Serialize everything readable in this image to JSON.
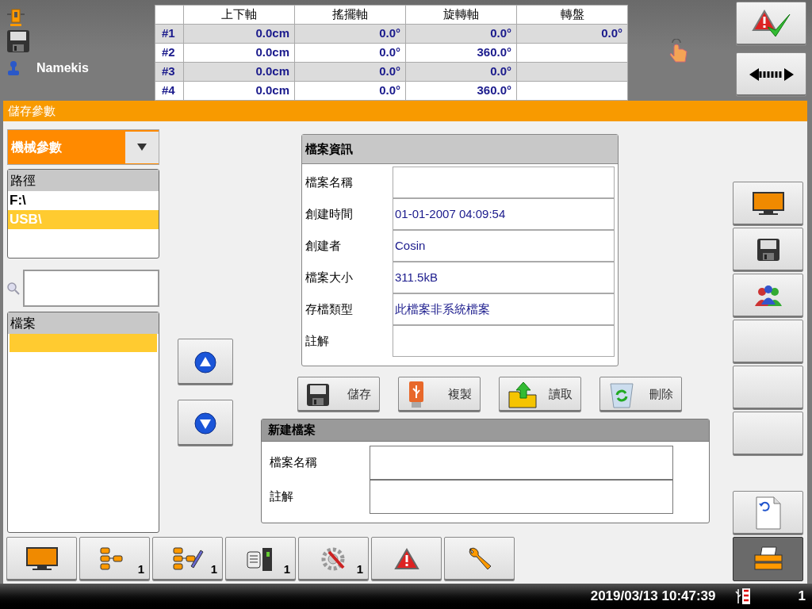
{
  "header": {
    "user": "Namekis"
  },
  "axis_table": {
    "columns": [
      "上下軸",
      "搖擺軸",
      "旋轉軸",
      "轉盤"
    ],
    "rows": [
      {
        "label": "#1",
        "cells": [
          "0.0cm",
          "0.0°",
          "0.0°",
          "0.0°"
        ]
      },
      {
        "label": "#2",
        "cells": [
          "0.0cm",
          "0.0°",
          "360.0°",
          ""
        ]
      },
      {
        "label": "#3",
        "cells": [
          "0.0cm",
          "0.0°",
          "0.0°",
          ""
        ]
      },
      {
        "label": "#4",
        "cells": [
          "0.0cm",
          "0.0°",
          "360.0°",
          ""
        ]
      }
    ]
  },
  "top_buttons": [
    {
      "kind": "alarm-ack"
    },
    {
      "kind": "arrows"
    }
  ],
  "page_title": "儲存參數",
  "category_dropdown": {
    "value": "機械參數"
  },
  "path_list": {
    "heading": "路徑",
    "items": [
      {
        "label": "F:\\",
        "selected": false
      },
      {
        "label": "USB\\",
        "selected": true
      }
    ]
  },
  "file_list": {
    "heading": "檔案",
    "items": [
      {
        "selected": true
      }
    ]
  },
  "file_info": {
    "title": "檔案資訊",
    "fields": [
      {
        "label": "檔案名稱"
      },
      {
        "label": "創建時間",
        "value": "01-01-2007 04:09:54"
      },
      {
        "label": "創建者",
        "value": "Cosin"
      },
      {
        "label": "檔案大小",
        "value": "311.5kB"
      },
      {
        "label": "存檔類型",
        "value": "此檔案非系統檔案"
      },
      {
        "label": "註解"
      }
    ]
  },
  "action_buttons": [
    {
      "kind": "save",
      "label": "儲存"
    },
    {
      "kind": "usb",
      "label": "複製"
    },
    {
      "kind": "load",
      "label": "讀取"
    },
    {
      "kind": "delete",
      "label": "刪除"
    }
  ],
  "new_file": {
    "title": "新建檔案",
    "fields": [
      {
        "label": "檔案名稱"
      },
      {
        "label": "註解"
      }
    ]
  },
  "side_buttons": [
    {
      "kind": "monitor",
      "selected": false
    },
    {
      "kind": "save",
      "selected": false
    },
    {
      "kind": "users",
      "selected": false
    },
    {
      "kind": "blank",
      "selected": false
    },
    {
      "kind": "blank",
      "selected": false
    },
    {
      "kind": "blank",
      "selected": false
    }
  ],
  "lower_side_buttons": [
    {
      "kind": "document",
      "selected": false
    },
    {
      "kind": "printer",
      "selected": true
    }
  ],
  "toolbar": [
    {
      "kind": "monitor"
    },
    {
      "kind": "tree",
      "badge": "1"
    },
    {
      "kind": "tree-edit",
      "badge": "1"
    },
    {
      "kind": "drive",
      "badge": "1"
    },
    {
      "kind": "gear",
      "badge": "1"
    },
    {
      "kind": "alarm"
    },
    {
      "kind": "wrench"
    }
  ],
  "status_bar": {
    "datetime": "2019/03/13 10:47:39",
    "count": "1"
  }
}
